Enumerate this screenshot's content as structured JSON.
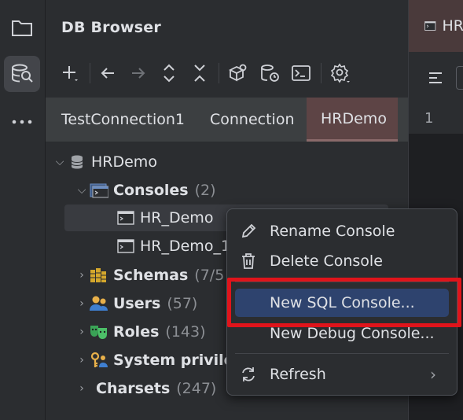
{
  "tool_window": {
    "title": "DB Browser"
  },
  "tabs": [
    {
      "label": "TestConnection1",
      "selected": false
    },
    {
      "label": "Connection",
      "selected": false
    },
    {
      "label": "HRDemo",
      "selected": true
    }
  ],
  "tree": {
    "root": {
      "label": "HRDemo"
    },
    "consoles": {
      "label": "Consoles",
      "count": "(2)"
    },
    "console_items": [
      "HR_Demo",
      "HR_Demo_1"
    ],
    "schemas": {
      "label": "Schemas",
      "count": "(7/5"
    },
    "users": {
      "label": "Users",
      "count": "(57)"
    },
    "roles": {
      "label": "Roles",
      "count": "(143)"
    },
    "privileges": {
      "label": "System privile"
    },
    "charsets": {
      "label": "Charsets",
      "count": "(247)"
    }
  },
  "editor": {
    "tab_label": "HR",
    "line_number": "1"
  },
  "context_menu": {
    "items": [
      {
        "label": "Rename Console",
        "icon": "pencil-icon"
      },
      {
        "label": "Delete Console",
        "icon": "trash-icon"
      },
      {
        "label": "New SQL Console...",
        "highlighted": true
      },
      {
        "label": "New Debug Console..."
      },
      {
        "label": "Refresh",
        "icon": "refresh-icon",
        "submenu": true
      }
    ]
  },
  "colors": {
    "highlight": "#2e436e",
    "annotation_box": "#e0141b",
    "selected_tab": "#5d4445"
  }
}
